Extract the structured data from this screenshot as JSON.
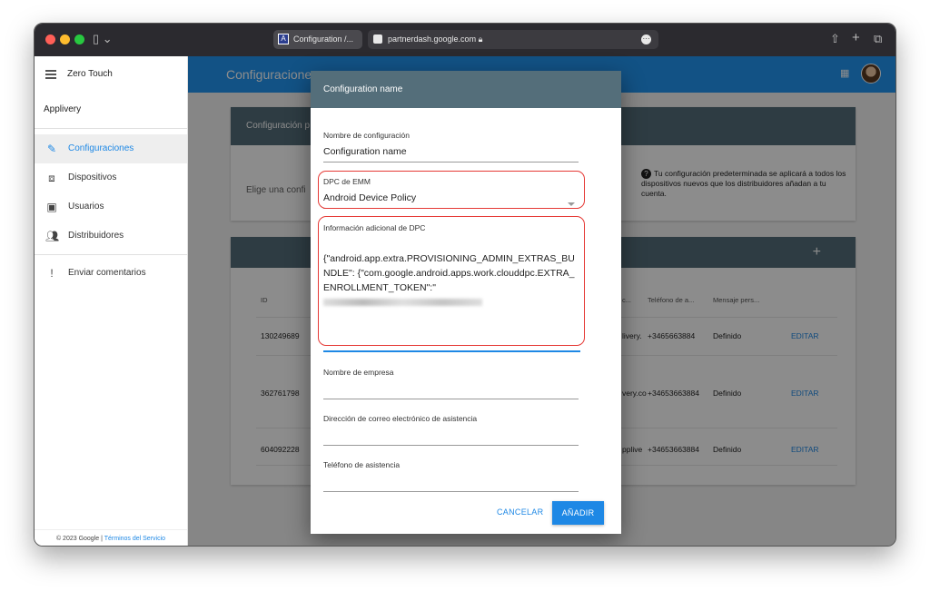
{
  "browser": {
    "tab_title": "Configuration /...",
    "url": "partnerdash.google.com",
    "lock_icon": "lock-icon"
  },
  "sidebar": {
    "app_name": "Zero Touch",
    "org": "Applivery",
    "items": [
      {
        "label": "Configuraciones",
        "icon": "pencil-icon"
      },
      {
        "label": "Dispositivos",
        "icon": "devices-icon"
      },
      {
        "label": "Usuarios",
        "icon": "user-badge-icon"
      },
      {
        "label": "Distribuidores",
        "icon": "people-icon"
      },
      {
        "label": "Enviar comentarios",
        "icon": "feedback-icon"
      }
    ],
    "footer_prefix": "© 2023 Google | ",
    "footer_link": "Términos del Servicio"
  },
  "appbar": {
    "title": "Configuraciones"
  },
  "card1": {
    "title": "Configuración p",
    "select_placeholder": "Elige una confi",
    "info_text": "Tu configuración predeterminada se aplicará a todos los dispositivos nuevos que los distribuidores añadan a tu cuenta."
  },
  "table": {
    "headers": {
      "id": "ID",
      "email": "c...",
      "phone": "Teléfono de a...",
      "message": "Mensaje pers..."
    },
    "rows": [
      {
        "id": "130249689",
        "email": "livery.",
        "phone": "+3465663884",
        "message": "Definido",
        "action": "EDITAR"
      },
      {
        "id": "362761798",
        "email": "very.co",
        "phone": "+34653663884",
        "message": "Definido",
        "action": "EDITAR"
      },
      {
        "id": "604092228",
        "email": "pplive",
        "phone": "+34653663884",
        "message": "Definido",
        "action": "EDITAR"
      }
    ]
  },
  "dialog": {
    "title": "Configuration name",
    "config_name_label": "Nombre de configuración",
    "config_name_value": "Configuration name",
    "dpc_label": "DPC de EMM",
    "dpc_value": "Android Device Policy",
    "extra_label": "Información adicional de DPC",
    "extra_value": "{\"android.app.extra.PROVISIONING_ADMIN_EXTRAS_BUNDLE\": {\"com.google.android.apps.work.clouddpc.EXTRA_ENROLLMENT_TOKEN\":\"",
    "company_label": "Nombre de empresa",
    "company_value": "",
    "support_email_label": "Dirección de correo electrónico de asistencia",
    "support_email_value": "",
    "support_phone_label": "Teléfono de asistencia",
    "support_phone_value": "",
    "cancel_label": "CANCELAR",
    "add_label": "AÑADIR"
  },
  "colors": {
    "accent": "#2196f3",
    "header": "#546e7a",
    "highlight": "#e53935"
  }
}
